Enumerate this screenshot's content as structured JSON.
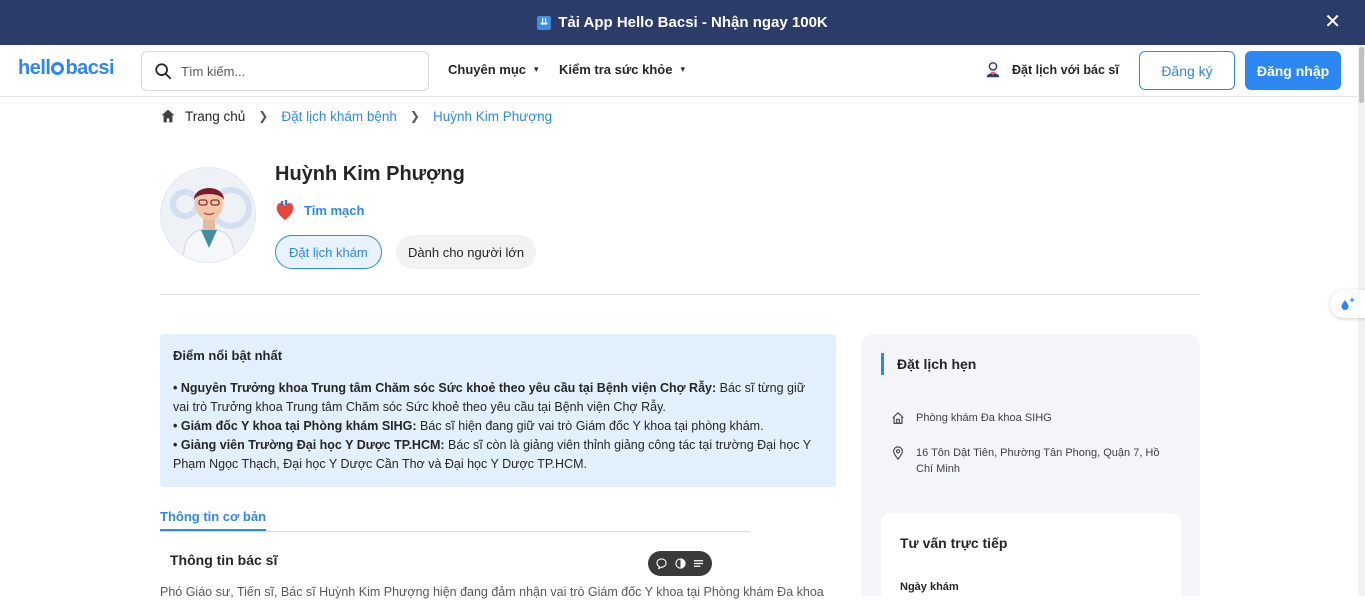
{
  "promo": {
    "icon": "download-icon",
    "text": "Tải App Hello Bacsi - Nhận ngay 100K",
    "close": "✕"
  },
  "header": {
    "search_placeholder": "Tìm kiếm...",
    "nav": [
      {
        "label": "Chuyên mục"
      },
      {
        "label": "Kiểm tra sức khỏe"
      }
    ],
    "book_label": "Đặt lịch với bác sĩ",
    "register_label": "Đăng ký",
    "login_label": "Đăng nhập",
    "accent": "#2d87f3"
  },
  "breadcrumb": {
    "home": "Trang chủ",
    "level1": "Đặt lịch khám bệnh",
    "level2": "Huỳnh Kim Phượng"
  },
  "doctor": {
    "name": "Huỳnh Kim Phượng",
    "specialty": "Tim mạch",
    "book_button": "Đặt lịch khám",
    "tag": "Dành cho người lớn"
  },
  "highlights": {
    "title": "Điểm nổi bật nhất",
    "items": [
      {
        "bold": "• Nguyên Trưởng khoa Trung tâm Chăm sóc Sức khoẻ theo yêu cầu tại Bệnh viện Chợ Rẫy:",
        "text": " Bác sĩ từng giữ vai trò Trưởng khoa Trung tâm Chăm sóc Sức khoẻ theo yêu cầu tại Bệnh viện Chợ Rẫy."
      },
      {
        "bold": "• Giám đốc Y khoa tại Phòng khám SIHG:",
        "text": " Bác sĩ hiện đang giữ vai trò Giám đốc Y khoa tại phòng khám."
      },
      {
        "bold": "• Giảng viên Trường Đại học Y Dược TP.HCM:",
        "text": " Bác sĩ còn là giảng viên thỉnh giảng công tác tại trường Đại học Y Phạm Ngọc Thạch, Đại học Y Dược Cần Thơ và Đại học Y Dược TP.HCM."
      }
    ]
  },
  "tabs": {
    "basic_info": "Thông tin cơ bản"
  },
  "info": {
    "section_title": "Thông tin bác sĩ",
    "text": "Phó Giáo sư, Tiến sĩ, Bác sĩ Huỳnh Kim Phượng hiện đang đảm nhận vai trò Giám đốc Y khoa tại Phòng khám Đa khoa"
  },
  "appointment": {
    "title": "Đặt lịch hẹn",
    "clinic": "Phòng khám Đa khoa SIHG",
    "address": "16 Tôn Dật Tiên, Phường Tân Phong, Quận 7, Hồ Chí Minh",
    "consult_title": "Tư vấn trực tiếp",
    "date_label": "Ngày khám"
  }
}
